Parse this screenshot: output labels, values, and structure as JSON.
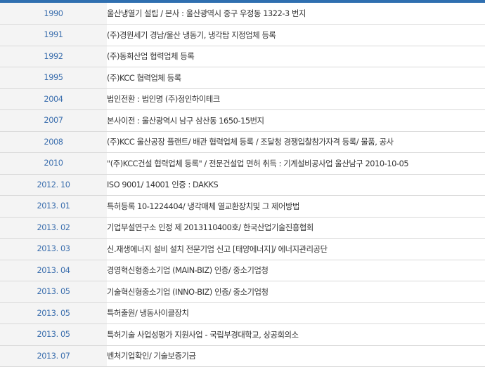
{
  "history": [
    {
      "year": "1990",
      "event": "울산냉열기 설립 / 본사 : 울산광역시 중구 우정동 1322-3 번지"
    },
    {
      "year": "1991",
      "event": "(주)경원세기 경남/울산 냉동기, 냉각탑 지정업체 등록"
    },
    {
      "year": "1992",
      "event": "(주)동희산업 협력업체 등록"
    },
    {
      "year": "1995",
      "event": "(주)KCC 협력업체 등록"
    },
    {
      "year": "2004",
      "event": "법인전환 : 법인명 (주)정인하이테크"
    },
    {
      "year": "2007",
      "event": "본사이전 : 울산광역시 남구 삼산동 1650-15번지"
    },
    {
      "year": "2008",
      "event": "(주)KCC 울산공장 플랜트/ 배관 협력업체 등록 / 조달청 경쟁입찰참가자격 등록/ 물품, 공사"
    },
    {
      "year": "2010",
      "event": "\"(주)KCC건설 협력업체 등록\" / 전문건설업 면허 취득 : 기계설비공사업 울산남구 2010-10-05"
    },
    {
      "year": "2012. 10",
      "event": "ISO 9001/ 14001 인증 : DAKKS"
    },
    {
      "year": "2013. 01",
      "event": "특허등록 10-1224404/ 냉각매체 열교환장치및 그 제어방법"
    },
    {
      "year": "2013. 02",
      "event": "기업부설연구소 인정 제 2013110400호/ 한국산업기술진흥협회"
    },
    {
      "year": "2013. 03",
      "event": "신.재생에너지 설비 설치 전문기업 신고 [태양에너지]/ 에너지관리공단"
    },
    {
      "year": "2013. 04",
      "event": "경영혁신형중소기업 (MAIN-BIZ) 인증/ 중소기업청"
    },
    {
      "year": "2013. 05",
      "event": "기술혁신형중소기업 (INNO-BIZ) 인증/ 중소기업청"
    },
    {
      "year": "2013. 05",
      "event": "특허출원/ 냉동사이클장치"
    },
    {
      "year": "2013. 05",
      "event": "특허기술 사업성평가 지원사업 - 국립부경대학교, 상공회의소"
    },
    {
      "year": "2013. 07",
      "event": "벤처기업확인/ 기술보증기금"
    }
  ]
}
